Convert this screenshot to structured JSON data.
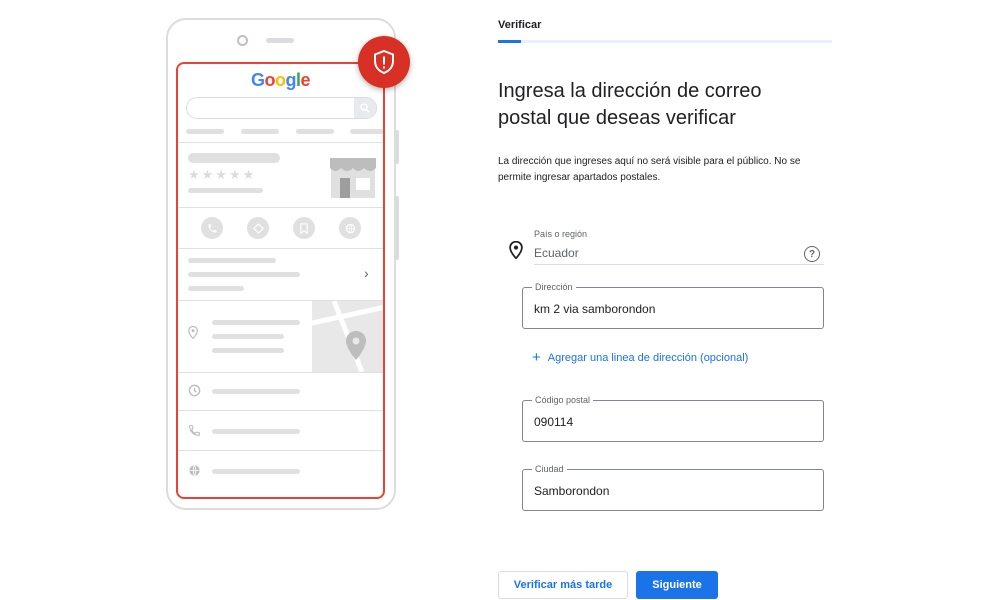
{
  "illustration": {
    "brand": {
      "letters": [
        "G",
        "o",
        "o",
        "g",
        "l",
        "e"
      ]
    },
    "colors": {
      "blue": "#4285f4",
      "red": "#ea4335",
      "yellow": "#fbbc05",
      "green": "#34a853",
      "badge": "#d93025"
    },
    "stars": "★★★★★",
    "icons": [
      "search-icon",
      "shop-icon",
      "phone-icon",
      "directions-icon",
      "bookmark-icon",
      "globe-icon",
      "map-pin-icon",
      "clock-icon",
      "shield-alert-icon"
    ]
  },
  "header": {
    "step_title": "Verificar",
    "progress": 0.07
  },
  "main": {
    "heading": "Ingresa la dirección de correo postal que deseas verificar",
    "description": "La dirección que ingreses aquí no será visible para el público. No se permite ingresar apartados postales."
  },
  "form": {
    "country": {
      "label": "País o región",
      "value": "Ecuador",
      "help": "?"
    },
    "address": {
      "label": "Dirección",
      "value": "km 2 via samborondon"
    },
    "add_line": {
      "icon": "+",
      "label": "Agregar una linea de dirección (opcional)"
    },
    "postal_code": {
      "label": "Código postal",
      "value": "090114"
    },
    "city": {
      "label": "Ciudad",
      "value": "Samborondon"
    }
  },
  "actions": {
    "later_label": "Verificar más tarde",
    "next_label": "Siguiente"
  },
  "theme": {
    "accent": "#1a73e8",
    "border": "#dadce0"
  }
}
